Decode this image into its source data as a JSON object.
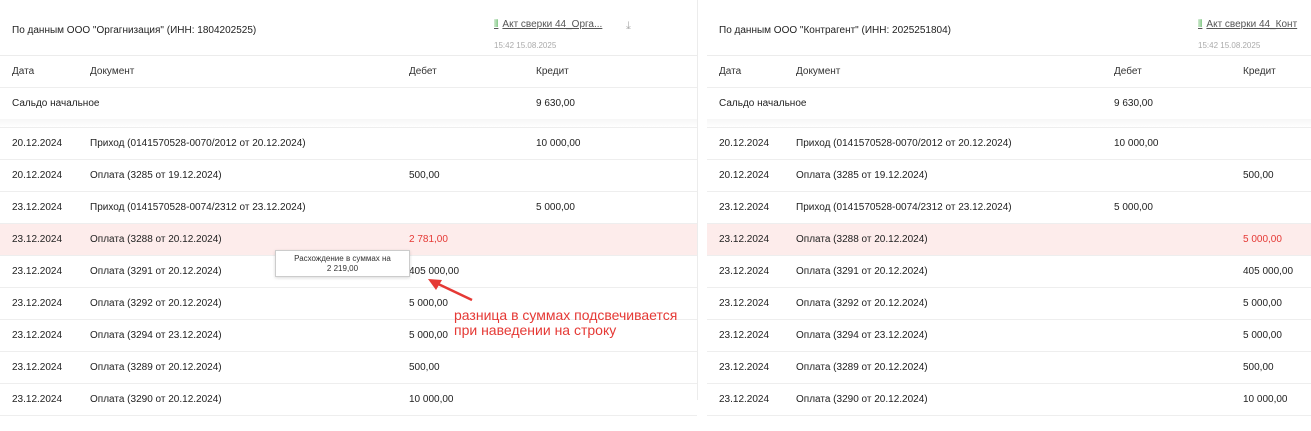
{
  "left": {
    "title": "По данным ООО \"Оргагнизация\" (ИНН: 1804202525)",
    "file": "Акт сверки 44_Орга...",
    "timestamp": "15:42 15.08.2025",
    "cols": {
      "date": "Дата",
      "doc": "Документ",
      "debit": "Дебет",
      "credit": "Кредит"
    },
    "saldo": {
      "label": "Сальдо начальное",
      "credit": "9 630,00"
    },
    "rows": [
      {
        "date": "20.12.2024",
        "doc": "Приход (0141570528-0070/2012 от 20.12.2024)",
        "debit": "",
        "credit": "10 000,00"
      },
      {
        "date": "20.12.2024",
        "doc": "Оплата (3285 от 19.12.2024)",
        "debit": "500,00",
        "credit": ""
      },
      {
        "date": "23.12.2024",
        "doc": "Приход (0141570528-0074/2312 от 23.12.2024)",
        "debit": "",
        "credit": "5 000,00"
      },
      {
        "date": "23.12.2024",
        "doc": "Оплата (3288 от 20.12.2024)",
        "debit": "2 781,00",
        "credit": ""
      },
      {
        "date": "23.12.2024",
        "doc": "Оплата (3291 от 20.12.2024)",
        "debit": "405 000,00",
        "credit": ""
      },
      {
        "date": "23.12.2024",
        "doc": "Оплата (3292 от 20.12.2024)",
        "debit": "5 000,00",
        "credit": ""
      },
      {
        "date": "23.12.2024",
        "doc": "Оплата (3294 от 23.12.2024)",
        "debit": "5 000,00",
        "credit": ""
      },
      {
        "date": "23.12.2024",
        "doc": "Оплата (3289 от 20.12.2024)",
        "debit": "500,00",
        "credit": ""
      },
      {
        "date": "23.12.2024",
        "doc": "Оплата (3290 от 20.12.2024)",
        "debit": "10 000,00",
        "credit": ""
      }
    ]
  },
  "right": {
    "title": "По данным ООО \"Контрагент\" (ИНН: 2025251804)",
    "file": "Акт сверки 44_Конт",
    "timestamp": "15:42 15.08.2025",
    "cols": {
      "date": "Дата",
      "doc": "Документ",
      "debit": "Дебет",
      "credit": "Кредит"
    },
    "saldo": {
      "label": "Сальдо начальное",
      "debit": "9 630,00"
    },
    "rows": [
      {
        "date": "20.12.2024",
        "doc": "Приход (0141570528-0070/2012 от 20.12.2024)",
        "debit": "10 000,00",
        "credit": ""
      },
      {
        "date": "20.12.2024",
        "doc": "Оплата (3285 от 19.12.2024)",
        "debit": "",
        "credit": "500,00"
      },
      {
        "date": "23.12.2024",
        "doc": "Приход (0141570528-0074/2312 от 23.12.2024)",
        "debit": "5 000,00",
        "credit": ""
      },
      {
        "date": "23.12.2024",
        "doc": "Оплата (3288 от 20.12.2024)",
        "debit": "",
        "credit": "5 000,00"
      },
      {
        "date": "23.12.2024",
        "doc": "Оплата (3291 от 20.12.2024)",
        "debit": "",
        "credit": "405 000,00"
      },
      {
        "date": "23.12.2024",
        "doc": "Оплата (3292 от 20.12.2024)",
        "debit": "",
        "credit": "5 000,00"
      },
      {
        "date": "23.12.2024",
        "doc": "Оплата (3294 от 23.12.2024)",
        "debit": "",
        "credit": "5 000,00"
      },
      {
        "date": "23.12.2024",
        "doc": "Оплата (3289 от 20.12.2024)",
        "debit": "",
        "credit": "500,00"
      },
      {
        "date": "23.12.2024",
        "doc": "Оплата (3290 от 20.12.2024)",
        "debit": "",
        "credit": "10 000,00"
      }
    ]
  },
  "tooltip": {
    "line1": "Расхождение в суммах на",
    "line2": "2 219,00"
  },
  "annotation": {
    "line1": "разница в суммах подсвечивается",
    "line2": "при наведении на строку"
  },
  "colors": {
    "highlight": "#fdeceb",
    "mismatch": "#e53935",
    "attachment": "#4caf50"
  }
}
